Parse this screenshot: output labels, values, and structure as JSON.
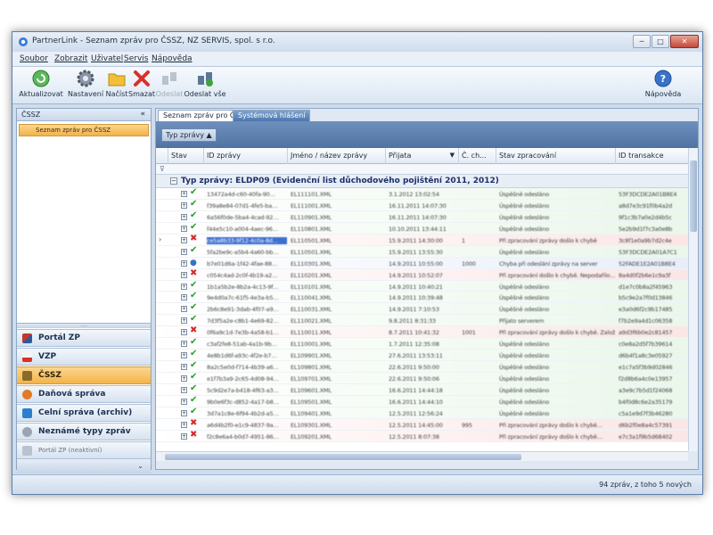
{
  "window": {
    "title": "PartnerLink - Seznam zpráv pro ČSSZ, NZ SERVIS, spol. s r.o.",
    "min": "─",
    "max": "□",
    "close": "✕"
  },
  "menu": [
    "Soubor",
    "Zobrazit",
    "Uživatel",
    "Servis",
    "Nápověda"
  ],
  "toolbar": {
    "refresh": "Aktualizovat",
    "settings": "Nastavení",
    "load": "Načíst",
    "delete": "Smazat",
    "send": "Odeslat",
    "send_all": "Odeslat vše",
    "help": "Nápověda"
  },
  "left_panel": {
    "header": "ČSSZ",
    "collapse": "«",
    "selected_item": "Seznam zpráv pro ČSSZ",
    "splitter": "....",
    "nav": [
      "Portál ZP",
      "VZP",
      "ČSSZ",
      "Daňová správa",
      "Celní správa (archiv)",
      "Neznámé typy zpráv",
      "Portál ZP (neaktivní)"
    ],
    "footer": "⌄"
  },
  "tabs": [
    "Seznam zpráv pro ČSSZ",
    "Systémová hlášení"
  ],
  "group_chip": "Typ zprávy ▲",
  "grid": {
    "columns": [
      "Stav",
      "ID zprávy",
      "Jméno / název zprávy",
      "Přijata",
      "Č. ch...",
      "Stav zpracování",
      "ID transakce"
    ],
    "sort_arrow": "▼",
    "filter_icon": "⊽",
    "group_label": "Typ zprávy: ELDP09 (Evidenční list důchodového pojištění 2011, 2012)",
    "rows": [
      {
        "s": "ok",
        "id": "13472a4d-c60-40fa-90…",
        "name": "EL111101.XML",
        "date": "3.1.2012 13:02:54",
        "ch": "",
        "proc": "Úspěšně odesláno",
        "tx": "53F3DCDE2A01B8E4"
      },
      {
        "s": "ok",
        "id": "f39a8e84-07d1-4fe5-ba…",
        "name": "EL111001.XML",
        "date": "16.11.2011 14:07:30",
        "ch": "",
        "proc": "Úspěšně odesláno",
        "tx": "a8d7e3c91f0b4a2d"
      },
      {
        "s": "ok",
        "id": "6a56f0de-5ba4-4cad-92…",
        "name": "EL110901.XML",
        "date": "16.11.2011 14:07:30",
        "ch": "",
        "proc": "Úspěšně odesláno",
        "tx": "9f1c3b7a0e2d4b5c"
      },
      {
        "s": "ok",
        "id": "f44e5c10-a004-4aec-96…",
        "name": "EL110801.XML",
        "date": "10.10.2011 13:44:11",
        "ch": "",
        "proc": "Úspěšně odesláno",
        "tx": "5e2b9d1f7c3a0e8b"
      },
      {
        "s": "err",
        "id": "ce5a8b33-9f12-4c0a-8d…",
        "name": "EL110501.XML",
        "date": "15.9.2011 14:30:00",
        "ch": "1",
        "proc": "Při zpracování zprávy došlo k chybě",
        "tx": "3c8f1e0a9b7d2c4e",
        "sel": true
      },
      {
        "s": "ok",
        "id": "5fa2be9c-a5b4-4a60-bb…",
        "name": "EL110501.XML",
        "date": "15.9.2011 13:55:30",
        "ch": "",
        "proc": "Úspěšně odesláno",
        "tx": "53F3DCDE2A01A7C1"
      },
      {
        "s": "info",
        "id": "b7e01d6a-1f42-4fae-88…",
        "name": "EL110301.XML",
        "date": "14.9.2011 10:55:00",
        "ch": "1000",
        "proc": "Chyba při odeslání zprávy na server",
        "tx": "52FADE1E2A01B8E4"
      },
      {
        "s": "err",
        "id": "c054c4ad-2c0f-4b19-a2…",
        "name": "EL110201.XML",
        "date": "14.9.2011 10:52:07",
        "ch": "",
        "proc": "Při zpracování došlo k chybě. Nepodařilo…",
        "tx": "8a4d0f2b6e1c9a3f"
      },
      {
        "s": "ok",
        "id": "1b1a5b2e-8b2a-4c13-9f…",
        "name": "EL110101.XML",
        "date": "14.9.2011 10:40:21",
        "ch": "",
        "proc": "Úspěšně odesláno",
        "tx": "d1e7c0b8a2f45963"
      },
      {
        "s": "ok",
        "id": "9e4d0a7c-61f5-4e3a-b5…",
        "name": "EL110041.XML",
        "date": "14.9.2011 10:39:48",
        "ch": "",
        "proc": "Úspěšně odesláno",
        "tx": "b5c9e2a7f0d13846"
      },
      {
        "s": "ok",
        "id": "2b6c8e91-3dab-4f07-a9…",
        "name": "EL110031.XML",
        "date": "14.9.2011 7:10:53",
        "ch": "",
        "proc": "Úspěšně odesláno",
        "tx": "e3a0d6f2c9b17485"
      },
      {
        "s": "ok",
        "id": "7d3f5a2e-c8b1-4e69-82…",
        "name": "EL110021.XML",
        "date": "9.8.2011 8:31:33",
        "ch": "",
        "proc": "Přijato serverem",
        "tx": "f7b2e9a4d1c06358"
      },
      {
        "s": "err",
        "id": "0f6a9c1d-7e3b-4a58-b1…",
        "name": "EL110011.XML",
        "date": "8.7.2011 10:41:32",
        "ch": "1001",
        "proc": "Při zpracování zprávy došlo k chybě. Založení…",
        "tx": "a9d3f6b0e2c81457"
      },
      {
        "s": "ok",
        "id": "c3af2fe8-51ab-4a1b-9b…",
        "name": "EL110001.XML",
        "date": "1.7.2011 12:35:08",
        "ch": "",
        "proc": "Úspěšně odesláno",
        "tx": "c0e8a2d5f7b39614"
      },
      {
        "s": "ok",
        "id": "4e8b1d6f-a93c-4f2e-b7…",
        "name": "EL109901.XML",
        "date": "27.6.2011 13:53:11",
        "ch": "",
        "proc": "Úspěšně odesláno",
        "tx": "d6b4f1a8c3e05927"
      },
      {
        "s": "ok",
        "id": "8a2c5e0d-f714-4b39-a6…",
        "name": "EL109801.XML",
        "date": "22.6.2011 9:50:00",
        "ch": "",
        "proc": "Úspěšně odesláno",
        "tx": "e1c7a5f3b9d02846"
      },
      {
        "s": "ok",
        "id": "e1f7b3a9-2c65-4d08-94…",
        "name": "EL109701.XML",
        "date": "22.6.2011 9:50:06",
        "ch": "",
        "proc": "Úspěšně odesláno",
        "tx": "f2d8b6a4c0e13957"
      },
      {
        "s": "ok",
        "id": "5c9d2e7a-b418-4f63-a3…",
        "name": "EL109601.XML",
        "date": "16.6.2011 14:44:18",
        "ch": "",
        "proc": "Úspěšně odesláno",
        "tx": "a3e9c7b5d1f24068"
      },
      {
        "s": "ok",
        "id": "9b0e6f3c-d852-4a17-b8…",
        "name": "EL109501.XML",
        "date": "16.6.2011 14:44:10",
        "ch": "",
        "proc": "Úspěšně odesláno",
        "tx": "b4f0d8c6e2a35179"
      },
      {
        "s": "ok",
        "id": "3d7a1c8e-6f94-4b2d-a5…",
        "name": "EL109401.XML",
        "date": "12.5.2011 12:56:24",
        "ch": "",
        "proc": "Úspěšně odesláno",
        "tx": "c5a1e9d7f3b46280"
      },
      {
        "s": "err",
        "id": "a6d4b2f0-e1c9-4837-9a…",
        "name": "EL109301.XML",
        "date": "12.5.2011 14:45:00",
        "ch": "995",
        "proc": "Při zpracování zprávy došlo k chybě…",
        "tx": "d6b2f0e8a4c57391"
      },
      {
        "s": "err",
        "id": "f2c8e6a4-b0d7-4951-86…",
        "name": "EL109201.XML",
        "date": "12.5.2011 8:07:38",
        "ch": "",
        "proc": "Při zpracování zprávy došlo k chybě…",
        "tx": "e7c3a1f9b5d68402"
      }
    ]
  },
  "status": "94 zpráv, z toho 5 nových",
  "colors": {
    "accent": "#f3b34a",
    "ok": "#2e9a2e",
    "err": "#d32a2a",
    "info": "#3a6fc9"
  }
}
